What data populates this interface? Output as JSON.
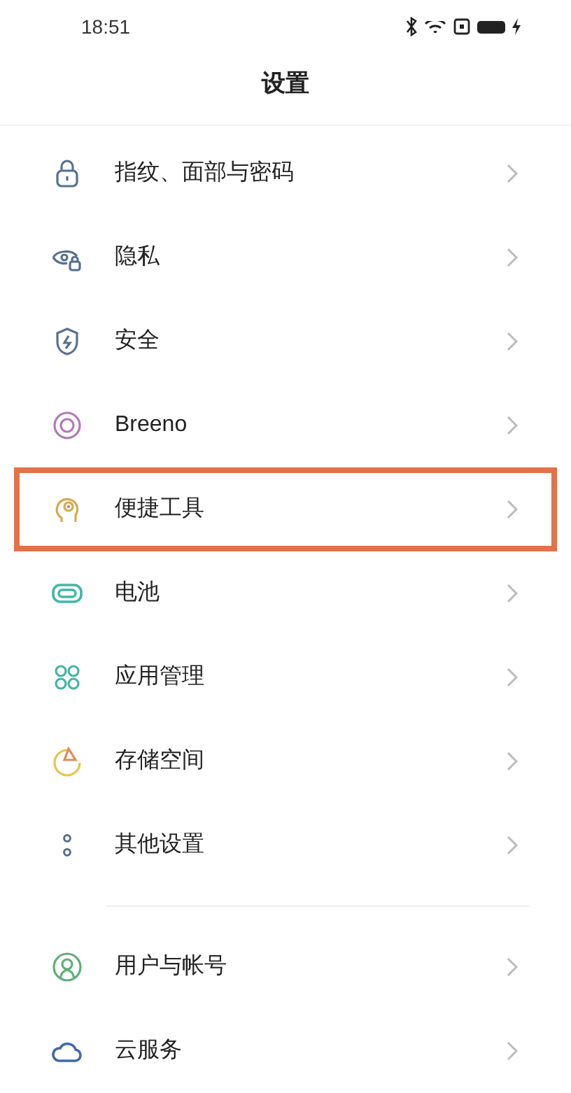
{
  "status_bar": {
    "time": "18:51"
  },
  "header": {
    "title": "设置"
  },
  "sections": [
    {
      "items": [
        {
          "label": "指纹、面部与密码",
          "highlighted": false
        },
        {
          "label": "隐私",
          "highlighted": false
        },
        {
          "label": "安全",
          "highlighted": false
        },
        {
          "label": "Breeno",
          "highlighted": false
        },
        {
          "label": "便捷工具",
          "highlighted": true
        },
        {
          "label": "电池",
          "highlighted": false
        },
        {
          "label": "应用管理",
          "highlighted": false
        },
        {
          "label": "存储空间",
          "highlighted": false
        },
        {
          "label": "其他设置",
          "highlighted": false
        }
      ]
    },
    {
      "items": [
        {
          "label": "用户与帐号",
          "highlighted": false
        },
        {
          "label": "云服务",
          "highlighted": false
        }
      ]
    }
  ]
}
